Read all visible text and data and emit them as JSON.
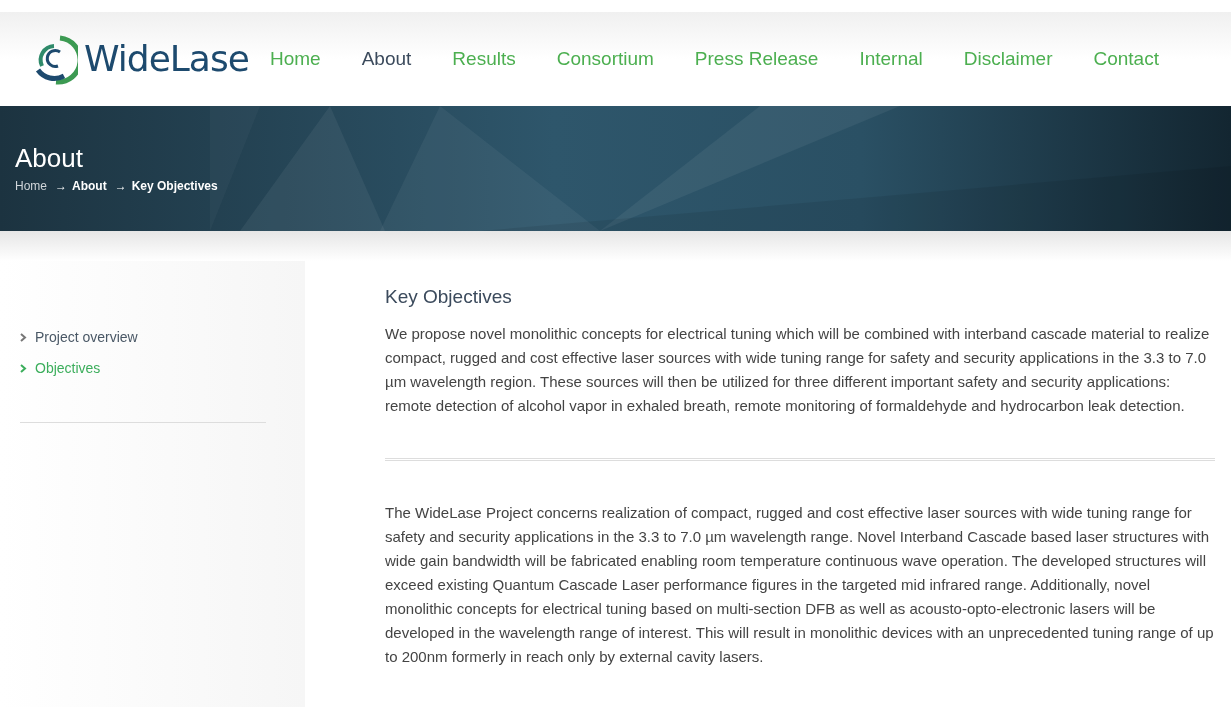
{
  "logo": {
    "text": "WideLase"
  },
  "nav": [
    {
      "label": "Home",
      "selected": false
    },
    {
      "label": "About",
      "selected": true
    },
    {
      "label": "Results",
      "selected": false
    },
    {
      "label": "Consortium",
      "selected": false
    },
    {
      "label": "Press Release",
      "selected": false
    },
    {
      "label": "Internal",
      "selected": false
    },
    {
      "label": "Disclaimer",
      "selected": false
    },
    {
      "label": "Contact",
      "selected": false
    }
  ],
  "banner": {
    "title": "About",
    "breadcrumb": [
      {
        "label": "Home",
        "current": false
      },
      {
        "label": "About",
        "current": true
      },
      {
        "label": "Key Objectives",
        "current": true
      }
    ],
    "separator": "→"
  },
  "sidebar": {
    "items": [
      {
        "label": "Project overview",
        "selected": false
      },
      {
        "label": "Objectives",
        "selected": true
      }
    ]
  },
  "content": {
    "heading": "Key Objectives",
    "paragraphs": [
      "We propose novel monolithic concepts for electrical tuning which will be combined with interband cascade material to realize compact, rugged and cost effective laser sources with wide tuning range for safety and security applications in the 3.3 to 7.0 µm wavelength region. These sources will then be utilized for three different important safety and security applications: remote detection of alcohol vapor in exhaled breath, remote monitoring of formaldehyde and hydrocarbon leak detection.",
      "The WideLase Project concerns realization of compact, rugged and cost effective laser sources with wide tuning range for safety and security applications in the 3.3 to 7.0 µm wavelength range. Novel Interband Cascade based laser structures with wide gain bandwidth will be fabricated enabling room temperature continuous wave operation. The developed structures will exceed existing Quantum Cascade Laser performance figures in the targeted mid infrared range. Additionally, novel monolithic concepts for electrical tuning based on multi-section DFB as well as acousto-opto-electronic lasers will be developed in the wavelength range of interest. This will result in monolithic devices with an unprecedented tuning range of up to 200nm formerly in reach only by external cavity lasers."
    ]
  }
}
